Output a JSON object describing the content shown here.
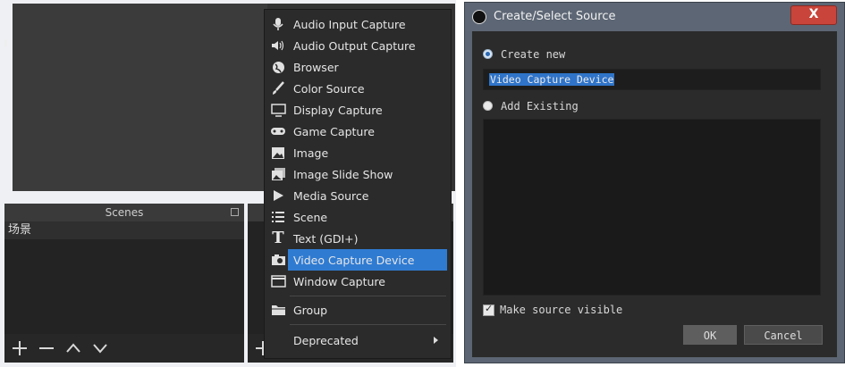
{
  "scenes_panel": {
    "header": "Scenes",
    "items": [
      "场景"
    ]
  },
  "context_menu": {
    "items": [
      {
        "label": "Audio Input Capture",
        "icon": "microphone-icon"
      },
      {
        "label": "Audio Output Capture",
        "icon": "speaker-icon"
      },
      {
        "label": "Browser",
        "icon": "globe-icon"
      },
      {
        "label": "Color Source",
        "icon": "brush-icon"
      },
      {
        "label": "Display Capture",
        "icon": "monitor-icon"
      },
      {
        "label": "Game Capture",
        "icon": "gamepad-icon"
      },
      {
        "label": "Image",
        "icon": "image-icon"
      },
      {
        "label": "Image Slide Show",
        "icon": "slideshow-icon"
      },
      {
        "label": "Media Source",
        "icon": "play-icon"
      },
      {
        "label": "Scene",
        "icon": "list-icon"
      },
      {
        "label": "Text (GDI+)",
        "icon": "text-icon"
      },
      {
        "label": "Video Capture Device",
        "icon": "camera-icon",
        "selected": true
      },
      {
        "label": "Window Capture",
        "icon": "window-icon"
      },
      {
        "label": "Group",
        "icon": "folder-icon"
      },
      {
        "label": "Deprecated",
        "icon": "",
        "has_submenu": true
      }
    ]
  },
  "dialog": {
    "title": "Create/Select Source",
    "close_label": "X",
    "create_new_label": "Create new",
    "name_value": "Video Capture Device",
    "add_existing_label": "Add Existing",
    "make_visible_label": "Make source visible",
    "make_visible_checked": true,
    "ok_label": "OK",
    "cancel_label": "Cancel"
  },
  "colors": {
    "selection": "#2f7bd2",
    "close_button": "#c9443a",
    "dialog_chrome": "#5b6573"
  }
}
